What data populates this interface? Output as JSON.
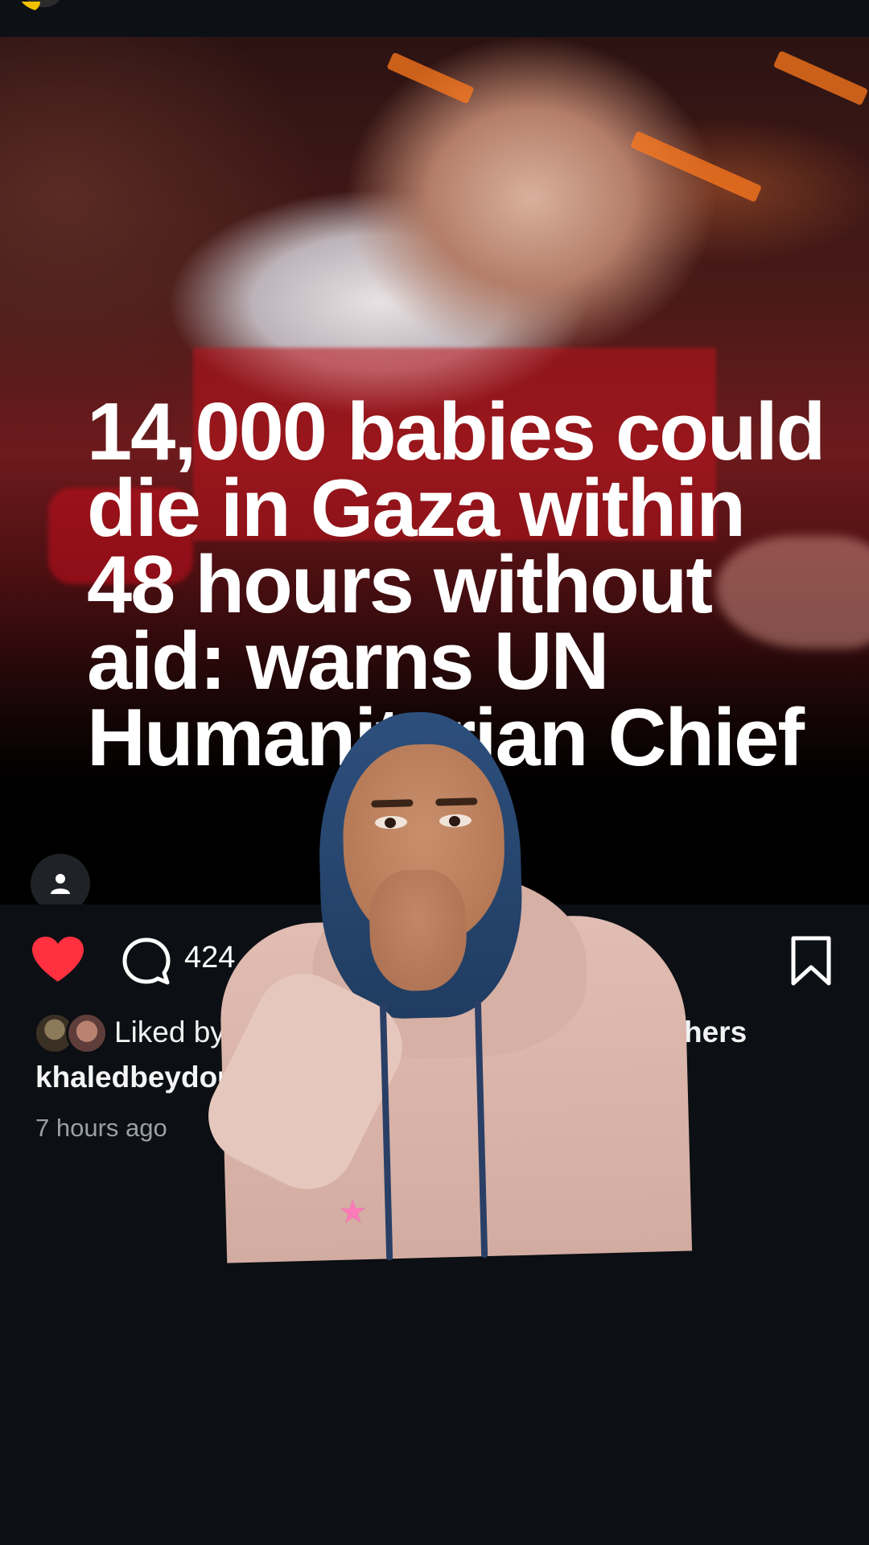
{
  "post": {
    "headline": "14,000 babies could die in Gaza within 48 hours without aid: warns UN Humanitarian Chief",
    "image_icons": {
      "tagged_people": "person-icon"
    }
  },
  "actions": {
    "liked": true,
    "like_icon": "heart-filled-icon",
    "comment_icon": "comment-bubble-icon",
    "comment_count": "424",
    "share_icon": "send-paper-plane-icon",
    "save_icon": "bookmark-icon",
    "like_color": "#ff3040"
  },
  "likes": {
    "prefix": "Liked by",
    "suffix": "hers"
  },
  "caption": {
    "username": "khaledbeydou"
  },
  "timestamp": "7 hours ago",
  "overlay": {
    "type": "creator-video-green-screen"
  }
}
